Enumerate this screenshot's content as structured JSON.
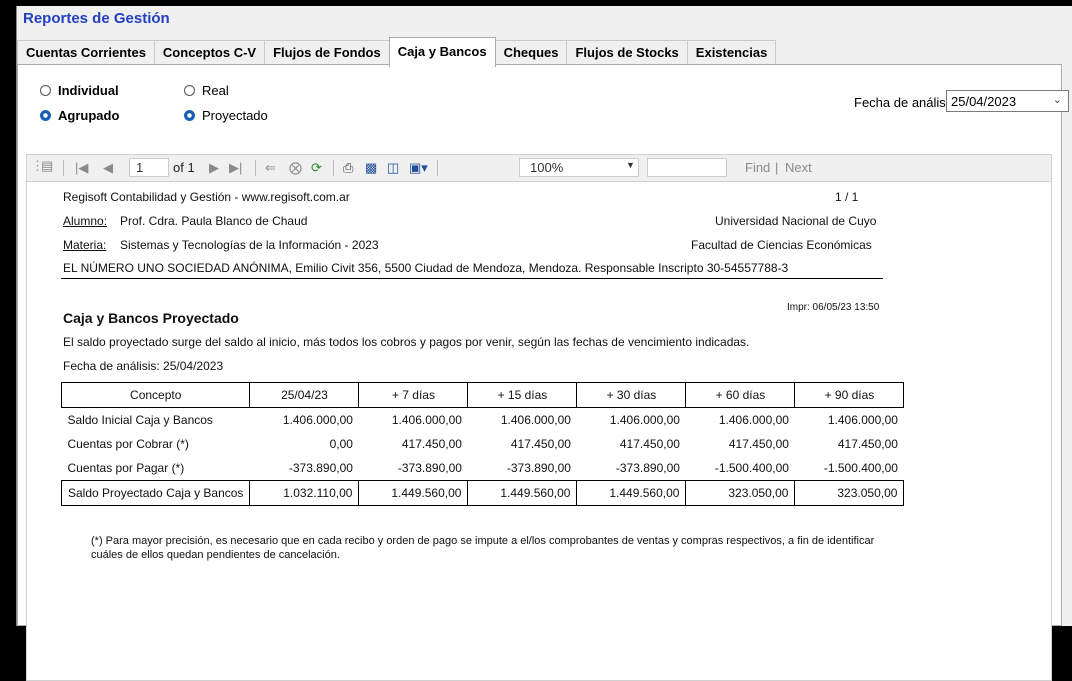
{
  "app": {
    "title": "Reportes de Gestión"
  },
  "tabs": [
    {
      "label": "Cuentas Corrientes",
      "active": false
    },
    {
      "label": "Conceptos C-V",
      "active": false
    },
    {
      "label": "Flujos de Fondos",
      "active": false
    },
    {
      "label": "Caja y Bancos",
      "active": true
    },
    {
      "label": "Cheques",
      "active": false
    },
    {
      "label": "Flujos de Stocks",
      "active": false
    },
    {
      "label": "Existencias",
      "active": false
    }
  ],
  "options": {
    "individual": {
      "label": "Individual",
      "selected": false
    },
    "agrupado": {
      "label": "Agrupado",
      "selected": true
    },
    "real": {
      "label": "Real",
      "selected": false
    },
    "proyectado": {
      "label": "Proyectado",
      "selected": true
    }
  },
  "fecha": {
    "label": "Fecha de análisis:",
    "value": "25/04/2023"
  },
  "toolbar": {
    "page": "1",
    "of_label": "of 1",
    "zoom": "100%",
    "find": "Find",
    "next": "Next"
  },
  "report": {
    "company": "Regisoft Contabilidad y Gestión  -  www.regisoft.com.ar",
    "page_counter": "1 / 1",
    "alumno_label": "Alumno:",
    "alumno": "Prof. Cdra. Paula Blanco de Chaud",
    "university": "Universidad Nacional de Cuyo",
    "materia_label": "Materia:",
    "materia": "Sistemas y Tecnologías de la Información - 2023",
    "faculty": "Facultad de Ciencias Económicas",
    "entity": "EL NÚMERO UNO SOCIEDAD ANÓNIMA, Emilio Civit 356, 5500 Ciudad de Mendoza, Mendoza.  Responsable Inscripto 30-54557788-3",
    "title": "Caja y Bancos Proyectado",
    "printed": "Impr: 06/05/23 13:50",
    "description": "El saldo proyectado surge del saldo al inicio, más todos los cobros y pagos por venir, según las fechas de vencimiento indicadas.",
    "fecha_line": "Fecha de análisis:  25/04/2023",
    "columns": [
      "Concepto",
      "25/04/23",
      "+ 7 días",
      "+ 15 días",
      "+ 30 días",
      "+ 60 días",
      "+ 90 días"
    ],
    "rows": [
      [
        "Saldo Inicial Caja y Bancos",
        "1.406.000,00",
        "1.406.000,00",
        "1.406.000,00",
        "1.406.000,00",
        "1.406.000,00",
        "1.406.000,00"
      ],
      [
        "Cuentas por Cobrar (*)",
        "0,00",
        "417.450,00",
        "417.450,00",
        "417.450,00",
        "417.450,00",
        "417.450,00"
      ],
      [
        "Cuentas por Pagar (*)",
        "-373.890,00",
        "-373.890,00",
        "-373.890,00",
        "-373.890,00",
        "-1.500.400,00",
        "-1.500.400,00"
      ]
    ],
    "total_row": [
      "Saldo Proyectado Caja y Bancos",
      "1.032.110,00",
      "1.449.560,00",
      "1.449.560,00",
      "1.449.560,00",
      "323.050,00",
      "323.050,00"
    ],
    "footnote": "(*) Para mayor precisión, es necesario que en cada recibo y orden de pago se impute a el/los comprobantes de ventas y compras respectivos, a fin de identificar cuáles de ellos quedan pendientes de cancelación."
  },
  "colors": {
    "title": "#2140c4",
    "radio_selected": "#1a5fb4"
  }
}
